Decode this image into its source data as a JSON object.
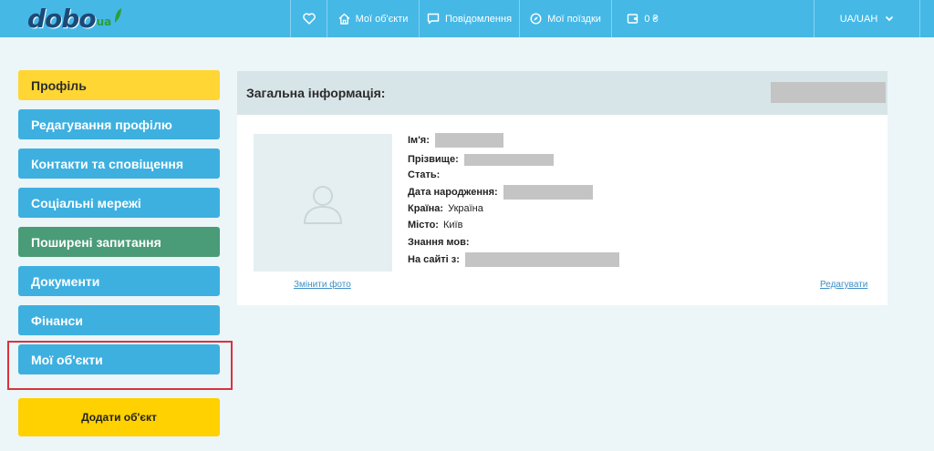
{
  "header": {
    "logo_text": "dobo",
    "logo_suffix": "ua",
    "nav": {
      "my_objects": "Мої об'єкти",
      "messages": "Повідомлення",
      "my_trips": "Мої поїздки",
      "balance": "0 ₴",
      "currency": "UA/UAH"
    }
  },
  "sidebar": {
    "items": [
      {
        "label": "Профіль"
      },
      {
        "label": "Редагування профілю"
      },
      {
        "label": "Контакти та сповіщення"
      },
      {
        "label": "Соціальні мережі"
      },
      {
        "label": "Поширені запитання"
      },
      {
        "label": "Документи"
      },
      {
        "label": "Фінанси"
      },
      {
        "label": "Мої об'єкти"
      }
    ],
    "add_object": "Додати об'єкт"
  },
  "profile": {
    "title": "Загальна інформація:",
    "fields": {
      "first_name": "Ім'я:",
      "last_name": "Прізвище:",
      "gender": "Стать:",
      "birth_date": "Дата народження:",
      "country": "Країна:",
      "country_value": "Україна",
      "city": "Місто:",
      "city_value": "Київ",
      "languages": "Знання мов:",
      "member_since": "На сайті з:"
    },
    "change_photo": "Змінити фото",
    "edit": "Редагувати"
  },
  "colors": {
    "topbar": "#45b8e6",
    "sidebar_blue": "#3db0e0",
    "sidebar_active": "#ffd633",
    "sidebar_faq": "#4a9b77",
    "add_button": "#ffd100",
    "highlight": "#d9333c"
  },
  "icons": {
    "favorites": "heart-icon",
    "my_objects": "home-icon",
    "messages": "chat-icon",
    "trips": "compass-icon",
    "balance": "wallet-icon",
    "currency": "chevron-down-icon",
    "avatar": "user-placeholder-icon"
  }
}
